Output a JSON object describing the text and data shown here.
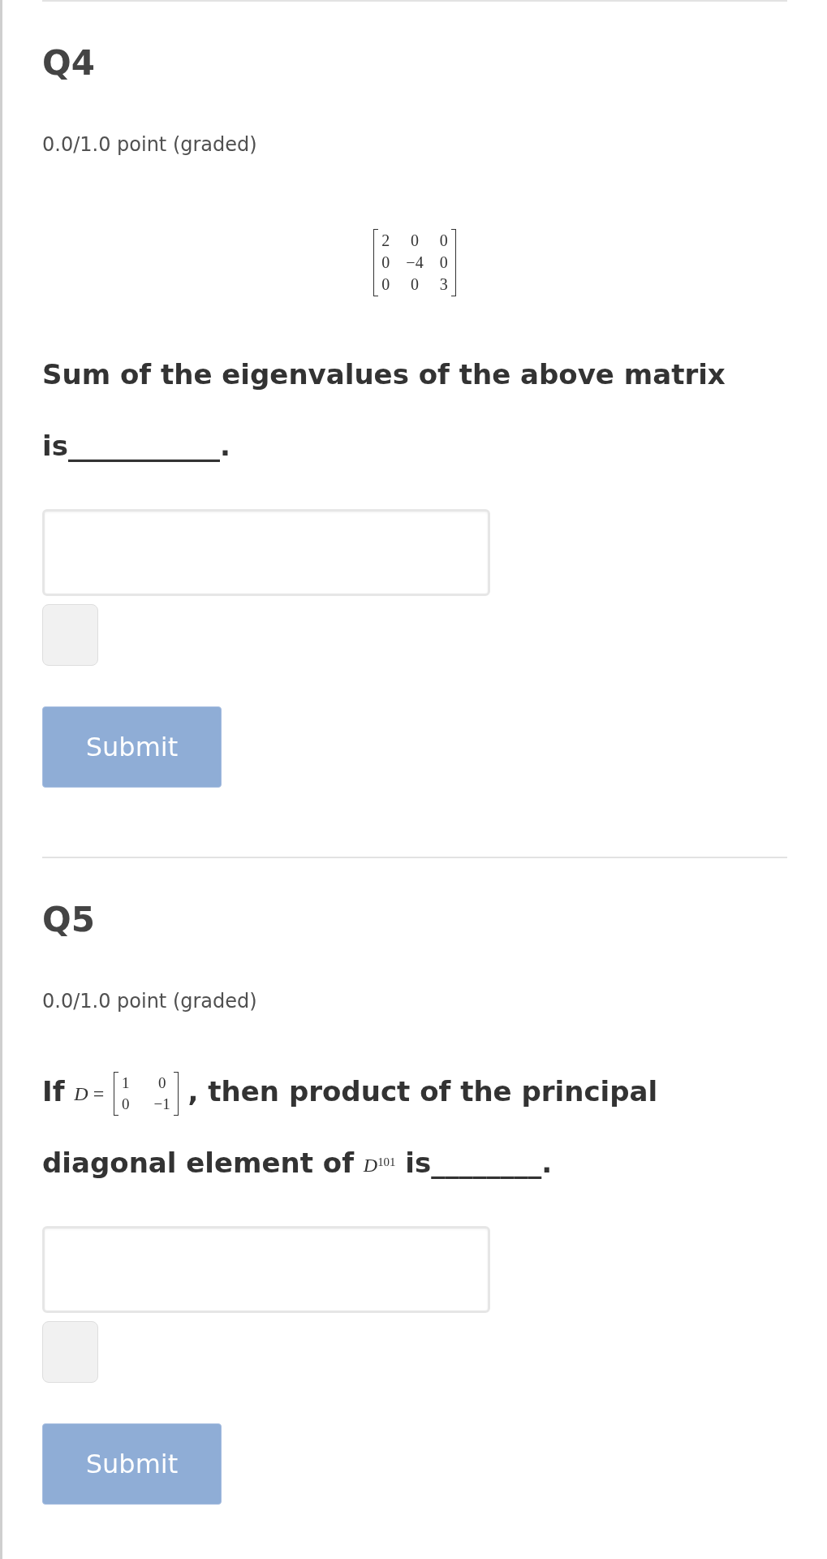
{
  "questions": [
    {
      "title": "Q4",
      "points": "0.0/1.0 point (graded)",
      "body": [
        {
          "kind": "display_matrix",
          "rows": [
            [
              "2",
              "0",
              "0"
            ],
            [
              "0",
              "−4",
              "0"
            ],
            [
              "0",
              "0",
              "3"
            ]
          ]
        },
        {
          "kind": "paragraph",
          "parts": [
            {
              "kind": "text",
              "text": "Sum of the eigenvalues of the above matrix is___________."
            }
          ]
        }
      ],
      "submit": {
        "label": "Submit",
        "disabled": true
      }
    },
    {
      "title": "Q5",
      "points": "0.0/1.0 point (graded)",
      "body": [
        {
          "kind": "paragraph",
          "parts": [
            {
              "kind": "text",
              "text": "If"
            },
            {
              "kind": "math",
              "text": "*D* ="
            },
            {
              "kind": "matrix",
              "rows": [
                [
                  "1",
                  "0"
                ],
                [
                  "0",
                  "−1"
                ]
              ]
            },
            {
              "kind": "text",
              "text": ", then product of the principal"
            },
            {
              "kind": "text",
              "text": "diagonal element of"
            },
            {
              "kind": "math",
              "text": "*D*$^{101}$"
            },
            {
              "kind": "text",
              "text": "is________."
            }
          ]
        }
      ],
      "submit": {
        "label": "Submit",
        "disabled": true
      }
    }
  ]
}
